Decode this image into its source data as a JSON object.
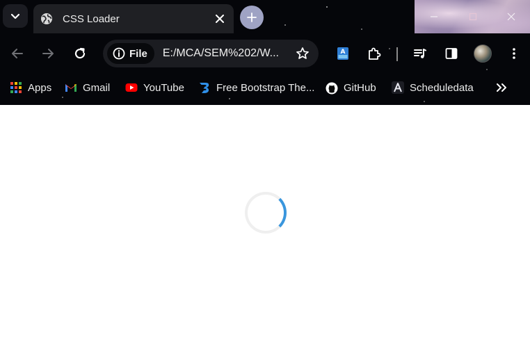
{
  "tab": {
    "title": "CSS Loader"
  },
  "omnibox": {
    "site_chip": "File",
    "url": "E:/MCA/SEM%202/W..."
  },
  "bookmarks": [
    {
      "label": "Apps",
      "icon": "apps-grid-icon"
    },
    {
      "label": "Gmail",
      "icon": "gmail-icon"
    },
    {
      "label": "YouTube",
      "icon": "youtube-icon"
    },
    {
      "label": "Free Bootstrap The...",
      "icon": "bootstrap-icon"
    },
    {
      "label": "GitHub",
      "icon": "github-icon"
    },
    {
      "label": "Scheduledata",
      "icon": "scheduledata-icon"
    }
  ],
  "colors": {
    "chrome_bg": "#05060a",
    "tab_bg": "#1f2024",
    "loader_track": "#efefef",
    "loader_accent": "#3a96dd",
    "page_bg": "#ffffff"
  }
}
